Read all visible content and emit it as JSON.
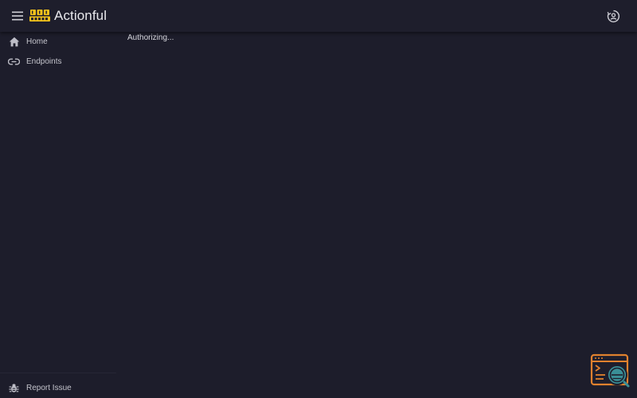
{
  "header": {
    "title": "Actionful",
    "menu_icon": "menu-icon",
    "logo_icon": "quark-logo",
    "account_icon": "account-circle-icon"
  },
  "sidebar": {
    "items": [
      {
        "label": "Home",
        "icon": "home-icon"
      },
      {
        "label": "Endpoints",
        "icon": "link-icon"
      }
    ],
    "footer": {
      "label": "Report Issue",
      "icon": "bug-icon"
    }
  },
  "main": {
    "status": "Authorizing..."
  },
  "colors": {
    "background": "#1d1d2b",
    "header": "#1e1e2c",
    "logo": "#f2c21b",
    "devtools_orange": "#e0812e",
    "devtools_teal": "#3a8f97"
  }
}
